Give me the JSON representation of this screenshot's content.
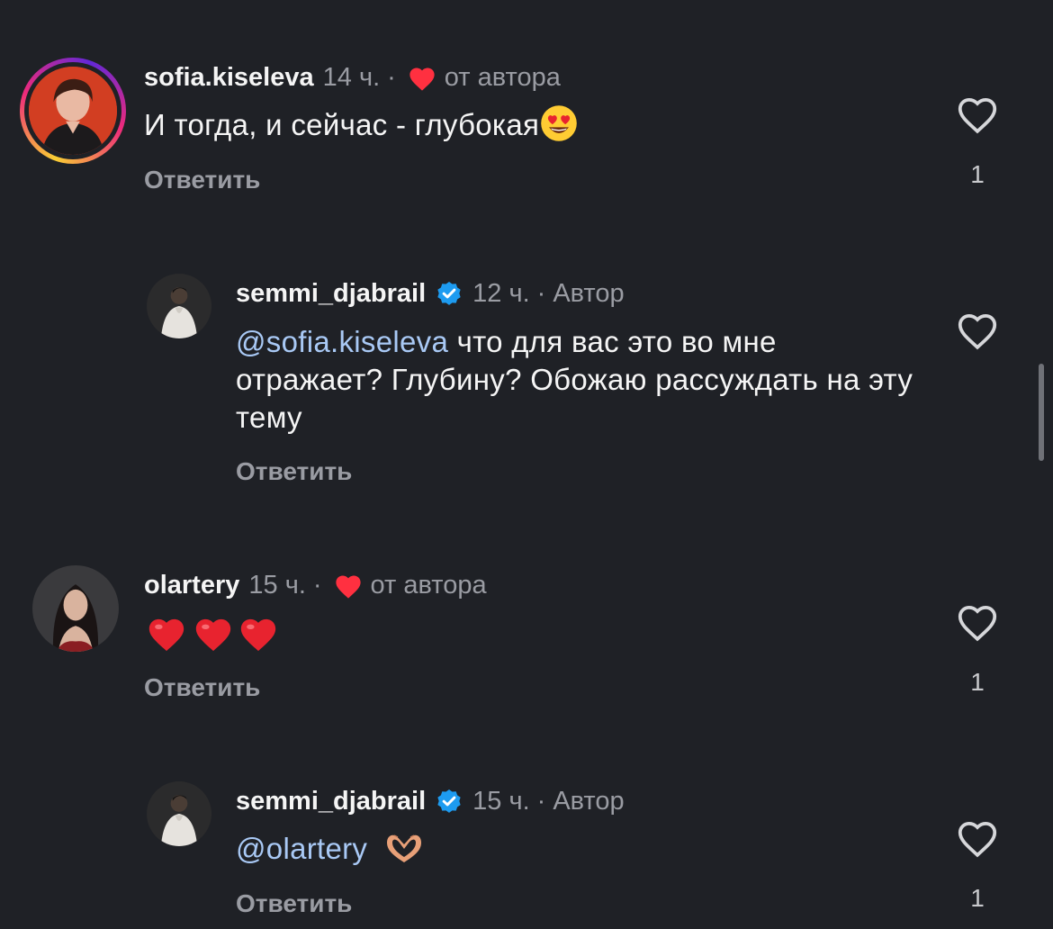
{
  "comments": [
    {
      "username": "sofia.kiseleva",
      "time": "14 ч.",
      "tag": "от автора",
      "text": "И тогда, и сейчас - глубокая",
      "reply_label": "Ответить",
      "likes": "1"
    },
    {
      "username": "semmi_djabrail",
      "time": "12 ч.",
      "tag": "Автор",
      "mention": "@sofia.kiseleva",
      "text": " что для вас это во мне отражает? Глубину? Обожаю рассуждать на эту тему",
      "reply_label": "Ответить",
      "likes": ""
    },
    {
      "username": "olartery",
      "time": "15 ч.",
      "tag": "от автора",
      "text": "",
      "reply_label": "Ответить",
      "likes": "1"
    },
    {
      "username": "semmi_djabrail",
      "time": "15 ч.",
      "tag": "Автор",
      "mention": "@olartery",
      "text": "",
      "reply_label": "Ответить",
      "likes": "1"
    }
  ],
  "separator": "·",
  "colors": {
    "background": "#1f2126",
    "secondary_text": "#9a9ca3",
    "mention": "#a9c9f5",
    "heart_red": "#ff3040",
    "verified_blue": "#1d9bf0"
  },
  "icons": {
    "like": "heart-outline-icon",
    "liked_by_author": "red-heart-icon",
    "verified": "verified-badge-icon",
    "emoji_love_eyes": "heart-eyes-emoji",
    "emoji_red_heart": "red-heart-emoji",
    "emoji_heart_hands": "heart-hands-emoji"
  }
}
